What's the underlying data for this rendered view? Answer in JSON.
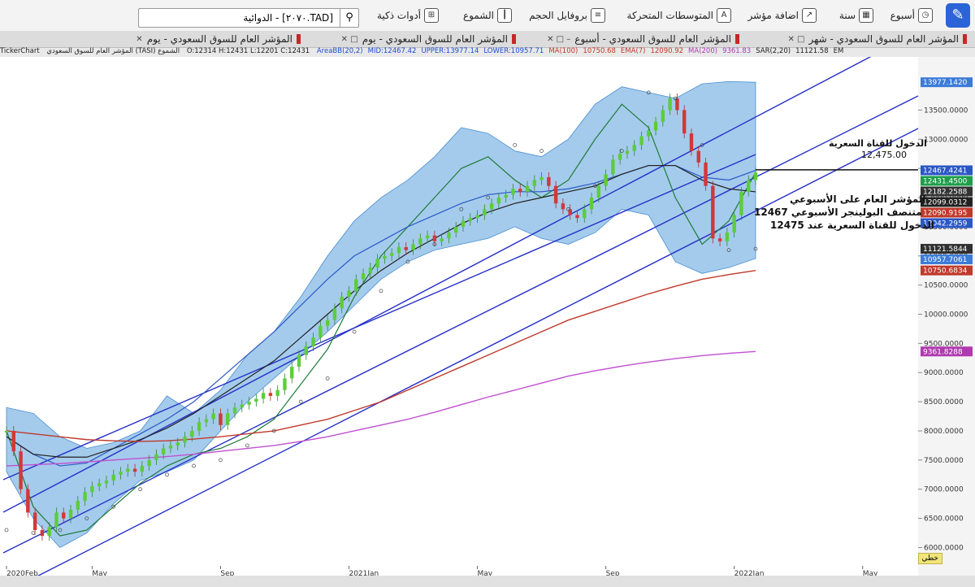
{
  "toolbar": {
    "items": [
      {
        "label": "أسبوع",
        "icon": "clock-icon"
      },
      {
        "label": "سنة",
        "icon": "calendar-icon"
      },
      {
        "label": "اضافة مؤشر",
        "icon": "add-indicator-icon"
      },
      {
        "label": "المتوسطات المتحركة",
        "icon": "moving-average-icon"
      },
      {
        "label": "بروفايل الحجم",
        "icon": "volume-profile-icon"
      },
      {
        "label": "الشموع",
        "icon": "candles-icon"
      },
      {
        "label": "أدوات ذكية",
        "icon": "smart-tools-icon"
      }
    ],
    "search_value": "[TAD.٢٠٧٠] - الدوائية"
  },
  "tabs": [
    {
      "label": "المؤشر العام للسوق السعودي - شهر"
    },
    {
      "label": "المؤشر العام للسوق السعودي - أسبوع"
    },
    {
      "label": "المؤشر العام للسوق السعودي - يوم"
    },
    {
      "label": "المؤشر العام للسوق السعودي - يوم"
    }
  ],
  "infobar": {
    "source": "TickerChart",
    "title": "المؤشر العام للسوق السعودي (TASI) الشموع",
    "ohlc": "O:12314 H:12431 L:12201 C:12431",
    "items": [
      {
        "text": "AreaBB(20,2)",
        "color": "#1a4dd0"
      },
      {
        "text": "MID:12467.42",
        "color": "#1a4dd0"
      },
      {
        "text": "UPPER:13977.14",
        "color": "#1a4dd0"
      },
      {
        "text": "LOWER:10957.71",
        "color": "#1a4dd0"
      },
      {
        "text": "MA(100)",
        "color": "#c0392b"
      },
      {
        "text": "10750.68",
        "color": "#c0392b"
      },
      {
        "text": "EMA(7)",
        "color": "#c0392b"
      },
      {
        "text": "12090.92",
        "color": "#c0392b"
      },
      {
        "text": "MA(200)",
        "color": "#b03ab0"
      },
      {
        "text": "9361.83",
        "color": "#b03ab0"
      },
      {
        "text": "SAR(2,20)",
        "color": "#222"
      },
      {
        "text": "11121.58",
        "color": "#222"
      },
      {
        "text": "EM",
        "color": "#222"
      }
    ]
  },
  "annotations": {
    "channel_entry_label": "الدخول للقناة السعرية",
    "channel_entry_value": "12,475.00",
    "note_line1": "المؤشر العام على الأسبوعي",
    "note_line2": "متنصف البولينجر الأسبوعي 12467",
    "note_line3": "الدخول للقناة السعرية عند 12475"
  },
  "bottom": {
    "label": "خطي"
  },
  "chart_data": {
    "type": "line",
    "title": "",
    "ylim": [
      5700,
      14300
    ],
    "y_ticks": [
      6000,
      6500,
      7000,
      7500,
      8000,
      8500,
      9000,
      9500,
      10000,
      10500,
      11000,
      11500,
      12000,
      12500,
      13000,
      13500
    ],
    "y_tick_labels": [
      "6000.0000",
      "6500.0000",
      "7000.0000",
      "7500.0000",
      "8000.0000",
      "8500.0000",
      "9000.0000",
      "9500.0000",
      "10000.0000",
      "10500.0000",
      "11000.0000",
      "11500.0000",
      "12000.0000",
      "12500.0000",
      "13000.0000",
      "13500.0000"
    ],
    "x_tick_labels": [
      "2020Feb",
      "May",
      "Sep",
      "2021Jan",
      "May",
      "Sep",
      "2022Jan",
      "May",
      "Sep"
    ],
    "x_tick_index": [
      0,
      12,
      30,
      48,
      66,
      84,
      102,
      120,
      138
    ],
    "price_badges": [
      {
        "value": 13977.142,
        "label": "13977.1420",
        "color": "#3d7bd9"
      },
      {
        "value": 12467.4241,
        "label": "12467.4241",
        "color": "#2a57c6"
      },
      {
        "value": 12431.45,
        "label": "12431.4500",
        "color": "#1e9e4a"
      },
      {
        "value": 12182.2588,
        "label": "12182.2588",
        "color": "#333333"
      },
      {
        "value": 12099.0312,
        "label": "12099.0312",
        "color": "#222222"
      },
      {
        "value": 12090.9195,
        "label": "12090.9195",
        "color": "#c0392b"
      },
      {
        "value": 12042.2959,
        "label": "12042.2959",
        "color": "#2a57c6"
      },
      {
        "value": 11121.5844,
        "label": "11121.5844",
        "color": "#303030"
      },
      {
        "value": 10957.7061,
        "label": "10957.7061",
        "color": "#3d7bd9"
      },
      {
        "value": 10750.6834,
        "label": "10750.6834",
        "color": "#c0392b"
      },
      {
        "value": 9361.8288,
        "label": "9361.8288",
        "color": "#b03ab0"
      }
    ],
    "channel_entry_level": 12475,
    "series": [
      {
        "values": [
          8000,
          6700,
          6200,
          6300,
          6700,
          7100,
          7400,
          7600,
          7700,
          7900,
          8200,
          8800,
          9400,
          10300,
          11000,
          11500,
          12000,
          12500,
          12700,
          12300,
          12000,
          12300,
          13000,
          13600,
          13200,
          12000,
          11200,
          11600,
          12431
        ]
      },
      {
        "values": [
          7900,
          7600,
          7400,
          7450,
          7700,
          7950,
          8200,
          8500,
          8900,
          9300,
          9700,
          10150,
          10600,
          11000,
          11250,
          11500,
          11700,
          11900,
          12050,
          12100,
          12100,
          12150,
          12250,
          12400,
          12550,
          12550,
          12350,
          12300,
          12467
        ]
      },
      {
        "values": [
          7900,
          7600,
          7550,
          7550,
          7700,
          7850,
          8050,
          8300,
          8600,
          8900,
          9200,
          9600,
          10000,
          10400,
          10750,
          11050,
          11300,
          11550,
          11750,
          11900,
          12000,
          12100,
          12200,
          12400,
          12550,
          12550,
          12300,
          12150,
          12099
        ]
      },
      {
        "values": [
          8000,
          7950,
          7900,
          7850,
          7830,
          7820,
          7830,
          7860,
          7900,
          7950,
          8000,
          8100,
          8200,
          8350,
          8500,
          8700,
          8900,
          9100,
          9300,
          9500,
          9700,
          9900,
          10050,
          10200,
          10350,
          10480,
          10600,
          10680,
          10750
        ]
      },
      {
        "values": [
          7400,
          7420,
          7440,
          7470,
          7500,
          7530,
          7560,
          7600,
          7650,
          7700,
          7750,
          7820,
          7900,
          8000,
          8100,
          8200,
          8320,
          8450,
          8580,
          8700,
          8820,
          8940,
          9030,
          9110,
          9180,
          9240,
          9290,
          9330,
          9361
        ]
      }
    ],
    "bb_upper": [
      8400,
      8300,
      7900,
      7700,
      7800,
      8000,
      8600,
      8300,
      8700,
      9300,
      9700,
      10300,
      11000,
      11600,
      12000,
      12300,
      12700,
      13200,
      13100,
      12800,
      12700,
      13000,
      13600,
      13900,
      13800,
      13700,
      13950,
      13990,
      13977
    ],
    "bb_lower": [
      7300,
      6500,
      6000,
      6250,
      6750,
      7150,
      7300,
      7500,
      8000,
      8500,
      8900,
      9300,
      9700,
      10150,
      10600,
      10900,
      11100,
      11200,
      11300,
      11500,
      11300,
      11200,
      11400,
      11800,
      11700,
      10900,
      10700,
      10800,
      10957
    ],
    "sar": [
      6300,
      6250,
      6300,
      6500,
      6700,
      7000,
      7250,
      7400,
      7500,
      7750,
      8000,
      8500,
      8900,
      9700,
      10400,
      10900,
      11200,
      11800,
      12000,
      12900,
      12800,
      11800,
      12200,
      12800,
      13800,
      13700,
      12900,
      11100,
      11121
    ],
    "candle_closes": [
      8000,
      7650,
      7000,
      6600,
      6300,
      6200,
      6350,
      6600,
      6500,
      6650,
      6800,
      6950,
      7050,
      7100,
      7150,
      7250,
      7300,
      7350,
      7300,
      7400,
      7500,
      7600,
      7700,
      7750,
      7800,
      7900,
      8000,
      8150,
      8200,
      8300,
      8100,
      8300,
      8400,
      8450,
      8500,
      8550,
      8650,
      8600,
      8700,
      8900,
      9100,
      9300,
      9450,
      9600,
      9800,
      9900,
      10100,
      10300,
      10400,
      10600,
      10700,
      10800,
      10950,
      11000,
      11050,
      11150,
      11100,
      11200,
      11300,
      11350,
      11250,
      11300,
      11400,
      11500,
      11600,
      11650,
      11700,
      11800,
      11900,
      12000,
      12050,
      12150,
      12100,
      12200,
      12300,
      12350,
      12200,
      11900,
      11800,
      11700,
      11650,
      11800,
      12000,
      12200,
      12400,
      12650,
      12750,
      12800,
      12900,
      13050,
      13150,
      13300,
      13500,
      13700,
      13500,
      13100,
      12800,
      12600,
      12200,
      11300,
      11250,
      11400,
      11700,
      12100,
      12300,
      12431
    ]
  }
}
